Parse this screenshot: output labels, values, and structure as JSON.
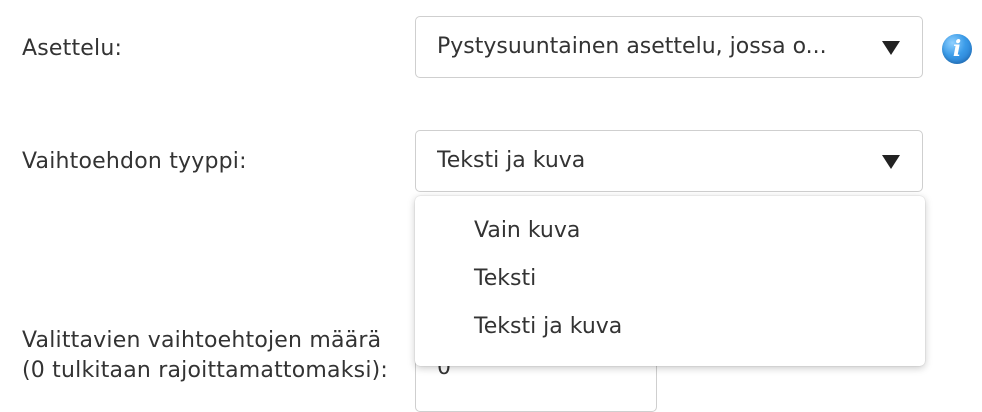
{
  "layout_row": {
    "label": "Asettelu:",
    "selected": "Pystysuuntainen asettelu, jossa o..."
  },
  "option_type_row": {
    "label": "Vaihtoehdon tyyppi:",
    "selected": "Teksti ja kuva"
  },
  "dropdown": {
    "options": [
      {
        "label": "Vain kuva"
      },
      {
        "label": "Teksti"
      },
      {
        "label": "Teksti ja kuva"
      }
    ]
  },
  "selectable_count_row": {
    "label_line1": "Valittavien vaihtoehtojen määrä",
    "label_line2": "(0 tulkitaan rajoittamattomaksi):",
    "value": "0"
  },
  "icons": {
    "info": "info-icon",
    "caret": "caret-down-icon"
  },
  "colors": {
    "info_blue": "#3a9be8",
    "text": "#333333",
    "border": "#cfcfcf"
  }
}
